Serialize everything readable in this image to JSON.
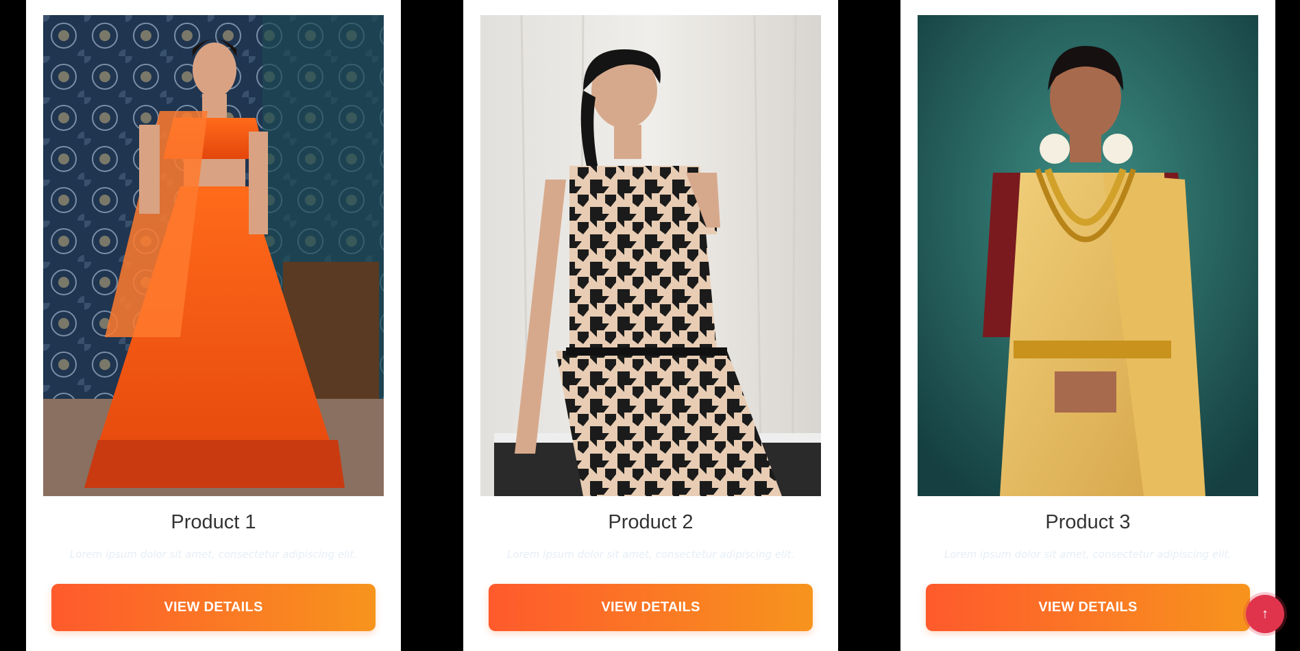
{
  "products": [
    {
      "title": "Product 1",
      "description": "Lorem ipsum dolor sit amet, consectetur adipiscing elit.",
      "button_label": "VIEW DETAILS",
      "image_name": "orange-lehenga-photo"
    },
    {
      "title": "Product 2",
      "description": "Lorem ipsum dolor sit amet, consectetur adipiscing elit.",
      "button_label": "VIEW DETAILS",
      "image_name": "houndstooth-dress-photo"
    },
    {
      "title": "Product 3",
      "description": "Lorem ipsum dolor sit amet, consectetur adipiscing elit.",
      "button_label": "VIEW DETAILS",
      "image_name": "gold-saree-photo"
    }
  ],
  "scroll_top": {
    "icon": "arrow-up-icon",
    "glyph": "↑"
  },
  "colors": {
    "page_background": "#000000",
    "card_background": "#ffffff",
    "button_gradient_start": "#ff5a2c",
    "button_gradient_end": "#f7941d",
    "scroll_top_background": "#e0344d"
  }
}
